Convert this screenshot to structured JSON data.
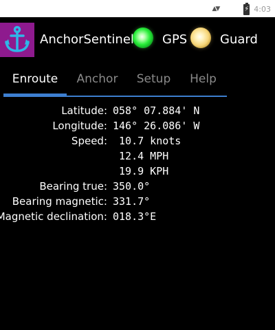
{
  "status_bar": {
    "time": "4:03"
  },
  "app": {
    "title": "AnchorSentinel",
    "indicators": [
      {
        "label": "GPS",
        "state_color": "#29ee3a"
      },
      {
        "label": "Guard",
        "state_color": "#f6d578"
      }
    ]
  },
  "tabs": [
    {
      "label": "Enroute",
      "active": true
    },
    {
      "label": "Anchor",
      "active": false
    },
    {
      "label": "Setup",
      "active": false
    },
    {
      "label": "Help",
      "active": false
    }
  ],
  "enroute": {
    "latitude": {
      "label": "Latitude:",
      "value": "058° 07.884' N"
    },
    "longitude": {
      "label": "Longitude:",
      "value": "146° 26.086' W"
    },
    "speed": {
      "label": "Speed:",
      "knots": " 10.7 knots",
      "mph": " 12.4 MPH",
      "kph": " 19.9 KPH"
    },
    "bearing_true": {
      "label": "Bearing true:",
      "value": "350.0°"
    },
    "bearing_magnetic": {
      "label": "Bearing magnetic:",
      "value": "331.7°"
    },
    "magnetic_declination": {
      "label": "Magnetic declination:",
      "value": "018.3°E"
    }
  },
  "colors": {
    "background": "#000000",
    "accent": "#3d7fd0",
    "app_icon_bg": "#8e1a8e",
    "anchor_icon": "#2fb6e8",
    "inactive_tab": "#8a8a8a"
  }
}
